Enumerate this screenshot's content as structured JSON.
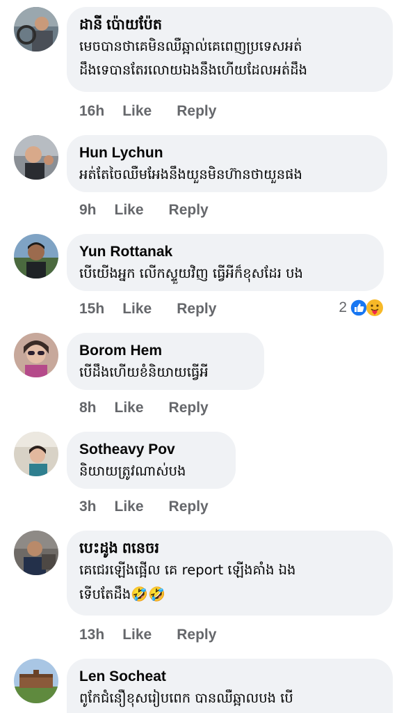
{
  "comments": [
    {
      "name": "ដានី ប៉ោយប៉ែត",
      "text": "មេចបានថាគេមិនឈឺឆ្អាល់គេពេញប្រទេសអត់\nដឹងទេបានតែរលោយឯងនឹងហើយដែលអត់ដឹង",
      "time": "16h",
      "like": "Like",
      "reply": "Reply"
    },
    {
      "name": "Hun Lychun",
      "text": "អត់តែចៃឈឺមអែងនឹងយួនមិនហ៊ានថាយួនផង",
      "time": "9h",
      "like": "Like",
      "reply": "Reply"
    },
    {
      "name": "Yun Rottanak",
      "text": "បើយើងអ្នក លើកស្ទួយវិញ ធ្វើអីក៏ខុសដែរ បង",
      "time": "15h",
      "like": "Like",
      "reply": "Reply",
      "reaction_count": "2"
    },
    {
      "name": "Borom Hem",
      "text": "បើដឹងហើយខំនិយាយធ្វើអី",
      "time": "8h",
      "like": "Like",
      "reply": "Reply"
    },
    {
      "name": "Sotheavy Pov",
      "text": "និយាយត្រូវណាស់បង",
      "time": "3h",
      "like": "Like",
      "reply": "Reply"
    },
    {
      "name": "បេះដូង ពនេចរ",
      "text": "គេជេរឡើងផ្អើល គេ report ឡើងគាំង ឯង\nទើបតែដឹង",
      "emoji": "🤣🤣",
      "time": "13h",
      "like": "Like",
      "reply": "Reply"
    },
    {
      "name": "Len Socheat",
      "text": "ពូកែជំនឿខុសរៀបពេក បានឈឺឆ្អាលបង បើ"
    }
  ],
  "colors": {
    "bubble": "#f0f2f5",
    "meta_text": "#65676b",
    "like_blue": "#1877f2",
    "care_yellow": "#f7b928"
  },
  "icons": {
    "reaction_1": "like-reaction-icon",
    "reaction_2": "care-reaction-icon"
  }
}
